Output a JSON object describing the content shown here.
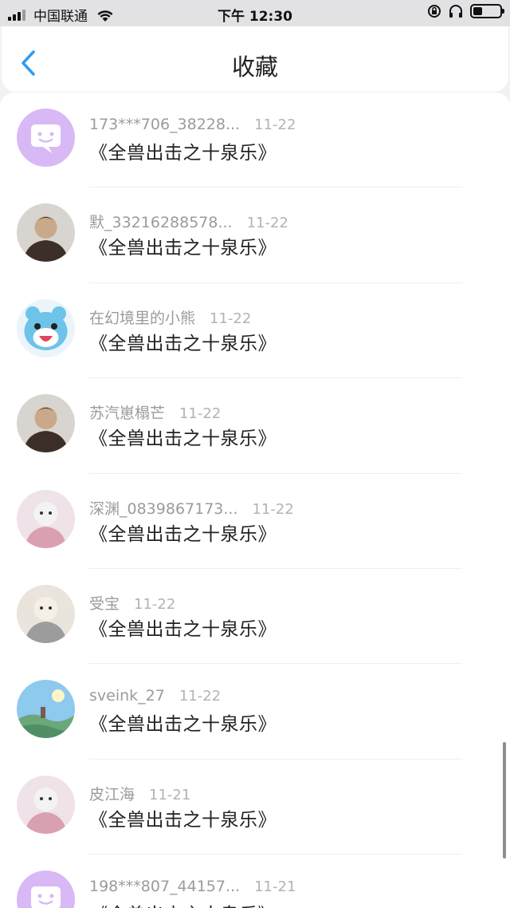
{
  "status_bar": {
    "carrier": "中国联通",
    "time": "下午 12:30",
    "battery_level": 0.35
  },
  "header": {
    "back_icon": "chevron-left-icon",
    "title": "收藏"
  },
  "colors": {
    "accent": "#2f9cf0",
    "placeholder_avatar": "#d9b8f6"
  },
  "list": [
    {
      "name": "173***706_38228...",
      "date": "11-22",
      "title": "《全兽出击之十泉乐》",
      "avatar": "placeholder-chat-avatar"
    },
    {
      "name": "默_33216288578...",
      "date": "11-22",
      "title": "《全兽出击之十泉乐》",
      "avatar": "user-photo-avatar"
    },
    {
      "name": "在幻境里的小熊",
      "date": "11-22",
      "title": "《全兽出击之十泉乐》",
      "avatar": "cartoon-bear-avatar"
    },
    {
      "name": "苏汽崽榻芒",
      "date": "11-22",
      "title": "《全兽出击之十泉乐》",
      "avatar": "user-photo-avatar"
    },
    {
      "name": "深渊_0839867173...",
      "date": "11-22",
      "title": "《全兽出击之十泉乐》",
      "avatar": "illustration-avatar"
    },
    {
      "name": "受宝",
      "date": "11-22",
      "title": "《全兽出击之十泉乐》",
      "avatar": "illustration-avatar"
    },
    {
      "name": "sveink_27",
      "date": "11-22",
      "title": "《全兽出击之十泉乐》",
      "avatar": "landscape-avatar"
    },
    {
      "name": "皮江海",
      "date": "11-21",
      "title": "《全兽出击之十泉乐》",
      "avatar": "illustration-avatar"
    },
    {
      "name": "198***807_44157...",
      "date": "11-21",
      "title": "《全兽出击之十泉乐》",
      "avatar": "placeholder-chat-avatar"
    }
  ]
}
